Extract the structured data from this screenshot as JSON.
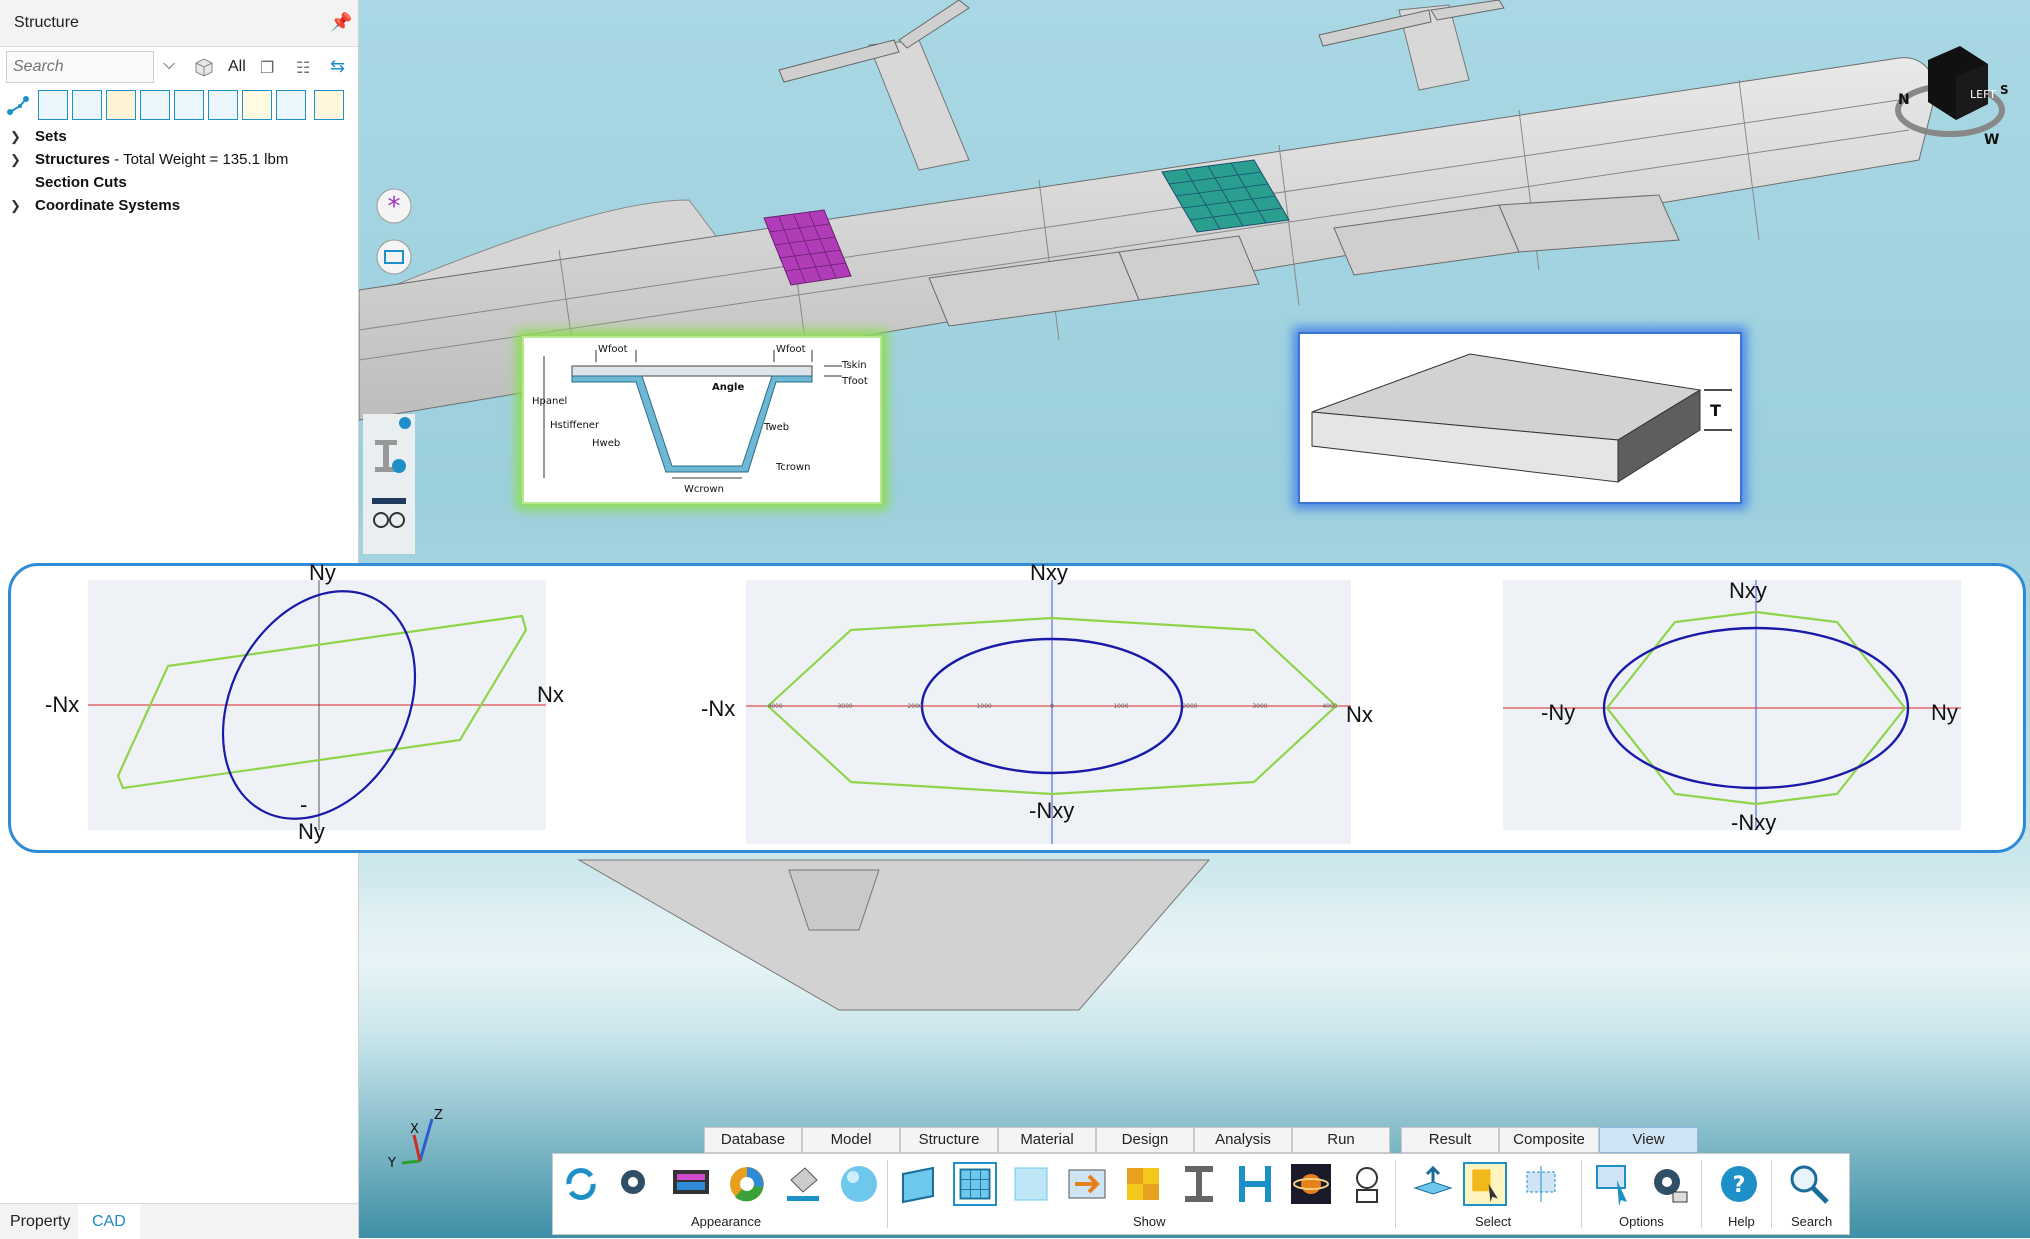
{
  "panel": {
    "title": "Structure",
    "search_placeholder": "Search",
    "all_label": "All",
    "tree": [
      {
        "label": "Sets",
        "extra": ""
      },
      {
        "label": "Structures",
        "extra": " - Total Weight = 135.1 lbm"
      },
      {
        "label": "Section Cuts",
        "extra": ""
      },
      {
        "label": "Coordinate Systems",
        "extra": ""
      }
    ],
    "bottom_tabs": {
      "property": "Property",
      "cad": "CAD"
    }
  },
  "inset_stiffener": {
    "w_foot_left": "Wfoot",
    "w_foot_right": "Wfoot",
    "t_skin": "Tskin",
    "t_foot": "Tfoot",
    "angle": "Angle",
    "h_panel": "Hpanel",
    "h_stiffener": "Hstiffener",
    "h_web": "Hweb",
    "t_web": "Tweb",
    "t_crown": "Tcrown",
    "w_crown": "Wcrown"
  },
  "inset_plate": {
    "t_label": "T"
  },
  "view_cube": {
    "face": "LEFT",
    "compass": [
      "N",
      "S",
      "W"
    ]
  },
  "envelopes": [
    {
      "top": "Ny",
      "bottom": "Ny",
      "bottom_extra": "-",
      "left": "-Nx",
      "right": "Nx"
    },
    {
      "top": "Nxy",
      "bottom": "-Nxy",
      "left": "-Nx",
      "right": "Nx",
      "ticks": [
        "-4000",
        "-3000",
        "-2000",
        "-1000",
        "0",
        "1000",
        "2000",
        "3000",
        "4000"
      ]
    },
    {
      "top": "Nxy",
      "bottom": "-Nxy",
      "left": "-Ny",
      "right": "Ny"
    }
  ],
  "ribbon": {
    "tabs": [
      "Database",
      "Model",
      "Structure",
      "Material",
      "Design",
      "Analysis",
      "Run",
      "Result",
      "Composite",
      "View"
    ],
    "active_tab": "View",
    "groups": [
      "Appearance",
      "Show",
      "Select",
      "Options",
      "Help",
      "Search"
    ]
  },
  "axis_triad": {
    "x": "X",
    "y": "Y",
    "z": "Z"
  },
  "colors": {
    "accent": "#1e90c8",
    "envelope_outer": "#8fd44a",
    "envelope_inner": "#1a1aaa",
    "axis_line": "#e05050",
    "purple_panel": "#b03cb8",
    "teal_panel": "#2a9e8f"
  }
}
